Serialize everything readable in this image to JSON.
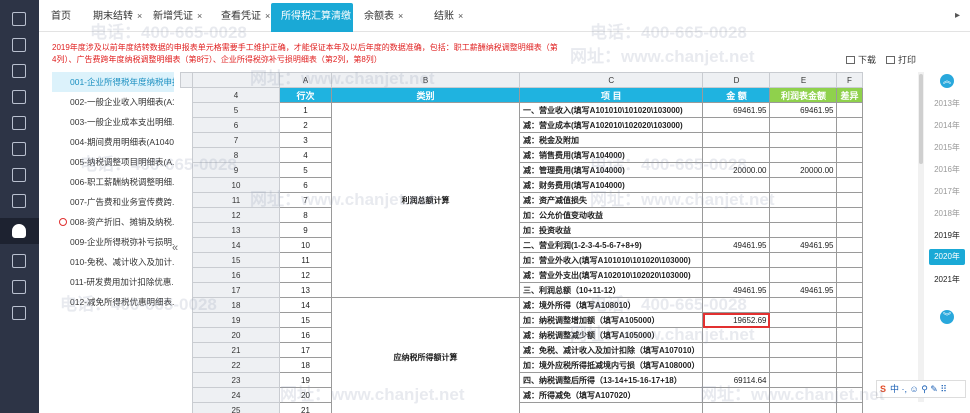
{
  "tabs": [
    {
      "label": "首页",
      "closable": false,
      "active": false
    },
    {
      "label": "期末结转",
      "closable": true,
      "active": false
    },
    {
      "label": "新增凭证",
      "closable": true,
      "active": false
    },
    {
      "label": "查看凭证",
      "closable": true,
      "active": false
    },
    {
      "label": "所得税汇算清缴",
      "closable": true,
      "active": true
    },
    {
      "label": "余额表",
      "closable": true,
      "active": false
    },
    {
      "label": "结账",
      "closable": true,
      "active": false
    }
  ],
  "close_glyph": "×",
  "notice": "2019年度涉及以前年度结转数据的申报表单元格需要手工维护正确，才能保证本年及以后年度的数据准确，包括：职工薪酬纳税调整明细表（第4列）、广告费跨年度纳税调整明细表（第8行）、企业所得税弥补亏损明细表（第2列，第8列）",
  "toolbar": {
    "download": "下载",
    "print": "打印"
  },
  "sidebar_items": [
    {
      "label": "001-企业所得税年度纳税申报...",
      "active": true,
      "warn": false
    },
    {
      "label": "002-一般企业收入明细表(A10...",
      "active": false,
      "warn": false
    },
    {
      "label": "003-一般企业成本支出明细...",
      "active": false,
      "warn": false
    },
    {
      "label": "004-期间费用明细表(A1040...",
      "active": false,
      "warn": false
    },
    {
      "label": "005-纳税调整项目明细表(A...",
      "active": false,
      "warn": false
    },
    {
      "label": "006-职工薪酬纳税调整明细...",
      "active": false,
      "warn": false
    },
    {
      "label": "007-广告费和业务宣传费跨...",
      "active": false,
      "warn": false
    },
    {
      "label": "008-资产折旧、摊销及纳税...",
      "active": false,
      "warn": true
    },
    {
      "label": "009-企业所得税弥补亏损明...",
      "active": false,
      "warn": false
    },
    {
      "label": "010-免税、减计收入及加计...",
      "active": false,
      "warn": false
    },
    {
      "label": "011-研发费用加计扣除优惠...",
      "active": false,
      "warn": false
    },
    {
      "label": "012-减免所得税优惠明细表...",
      "active": false,
      "warn": false
    }
  ],
  "collapse_glyph": "«",
  "sheet": {
    "col_letters": [
      "A",
      "B",
      "C",
      "D",
      "E",
      "F"
    ],
    "headers": [
      "行次",
      "类别",
      "项        目",
      "金        额",
      "利润表金额",
      "差异"
    ],
    "header_row_num": "4",
    "categories": [
      {
        "label": "利润总额计算",
        "start": 0,
        "span": 13
      },
      {
        "label": "应纳税所得额计算",
        "start": 13,
        "span": 8
      }
    ],
    "rows": [
      {
        "rn": "5",
        "seq": "1",
        "item": "一、营业收入(填写A101010\\101020\\103000)",
        "amount": "69461.95",
        "profit": "69461.95",
        "diff": ""
      },
      {
        "rn": "6",
        "seq": "2",
        "item": "    减：营业成本(填写A102010\\102020\\103000)",
        "amount": "",
        "profit": "",
        "diff": ""
      },
      {
        "rn": "7",
        "seq": "3",
        "item": "    减：税金及附加",
        "amount": "",
        "profit": "",
        "diff": ""
      },
      {
        "rn": "8",
        "seq": "4",
        "item": "    减：销售费用(填写A104000)",
        "amount": "",
        "profit": "",
        "diff": ""
      },
      {
        "rn": "9",
        "seq": "5",
        "item": "    减：管理费用(填写A104000)",
        "amount": "20000.00",
        "profit": "20000.00",
        "diff": ""
      },
      {
        "rn": "10",
        "seq": "6",
        "item": "    减：财务费用(填写A104000)",
        "amount": "",
        "profit": "",
        "diff": ""
      },
      {
        "rn": "11",
        "seq": "7",
        "item": "    减：资产减值损失",
        "amount": "",
        "profit": "",
        "diff": ""
      },
      {
        "rn": "12",
        "seq": "8",
        "item": "    加：公允价值变动收益",
        "amount": "",
        "profit": "",
        "diff": ""
      },
      {
        "rn": "13",
        "seq": "9",
        "item": "    加：投资收益",
        "amount": "",
        "profit": "",
        "diff": ""
      },
      {
        "rn": "14",
        "seq": "10",
        "item": "二、营业利润(1-2-3-4-5-6-7+8+9)",
        "amount": "49461.95",
        "profit": "49461.95",
        "diff": ""
      },
      {
        "rn": "15",
        "seq": "11",
        "item": "    加：营业外收入(填写A101010\\101020\\103000)",
        "amount": "",
        "profit": "",
        "diff": ""
      },
      {
        "rn": "16",
        "seq": "12",
        "item": "    减：营业外支出(填写A102010\\102020\\103000)",
        "amount": "",
        "profit": "",
        "diff": ""
      },
      {
        "rn": "17",
        "seq": "13",
        "item": "三、利润总额（10+11-12）",
        "amount": "49461.95",
        "profit": "49461.95",
        "diff": ""
      },
      {
        "rn": "18",
        "seq": "14",
        "item": "    减：境外所得（填写A108010）",
        "amount": "",
        "profit": "",
        "diff": ""
      },
      {
        "rn": "19",
        "seq": "15",
        "item": "    加：纳税调整增加额（填写A105000）",
        "amount": "19652.69",
        "profit": "",
        "diff": "",
        "selected": true
      },
      {
        "rn": "20",
        "seq": "16",
        "item": "    减：纳税调整减少额（填写A105000）",
        "amount": "",
        "profit": "",
        "diff": ""
      },
      {
        "rn": "21",
        "seq": "17",
        "item": "    减：免税、减计收入及加计扣除（填写A107010）",
        "amount": "",
        "profit": "",
        "diff": ""
      },
      {
        "rn": "22",
        "seq": "18",
        "item": "    加：境外应税所得抵减境内亏损（填写A108000）",
        "amount": "",
        "profit": "",
        "diff": ""
      },
      {
        "rn": "23",
        "seq": "19",
        "item": "四、纳税调整后所得（13-14+15-16-17+18）",
        "amount": "69114.64",
        "profit": "",
        "diff": ""
      },
      {
        "rn": "24",
        "seq": "20",
        "item": "    减：所得减免（填写A107020）",
        "amount": "",
        "profit": "",
        "diff": ""
      },
      {
        "rn": "25",
        "seq": "21",
        "item": "",
        "amount": "",
        "profit": "",
        "diff": ""
      }
    ]
  },
  "years": [
    "2013年",
    "2014年",
    "2015年",
    "2016年",
    "2017年",
    "2018年",
    "2019年",
    "2020年",
    "2021年"
  ],
  "active_year": "2020年",
  "year_nav": {
    "up": "︽",
    "down": "︾"
  },
  "ime": {
    "brand": "S",
    "text": "中 ·, ☺ ⚲ ✎ ⠿"
  },
  "watermarks": [
    "电话：400-665-0028",
    "网址：www.chanjet.net"
  ],
  "colors": {
    "accent": "#1aa9d6",
    "header_green": "#8fd14c",
    "notice_red": "#e02020",
    "rail": "#2d3446"
  }
}
